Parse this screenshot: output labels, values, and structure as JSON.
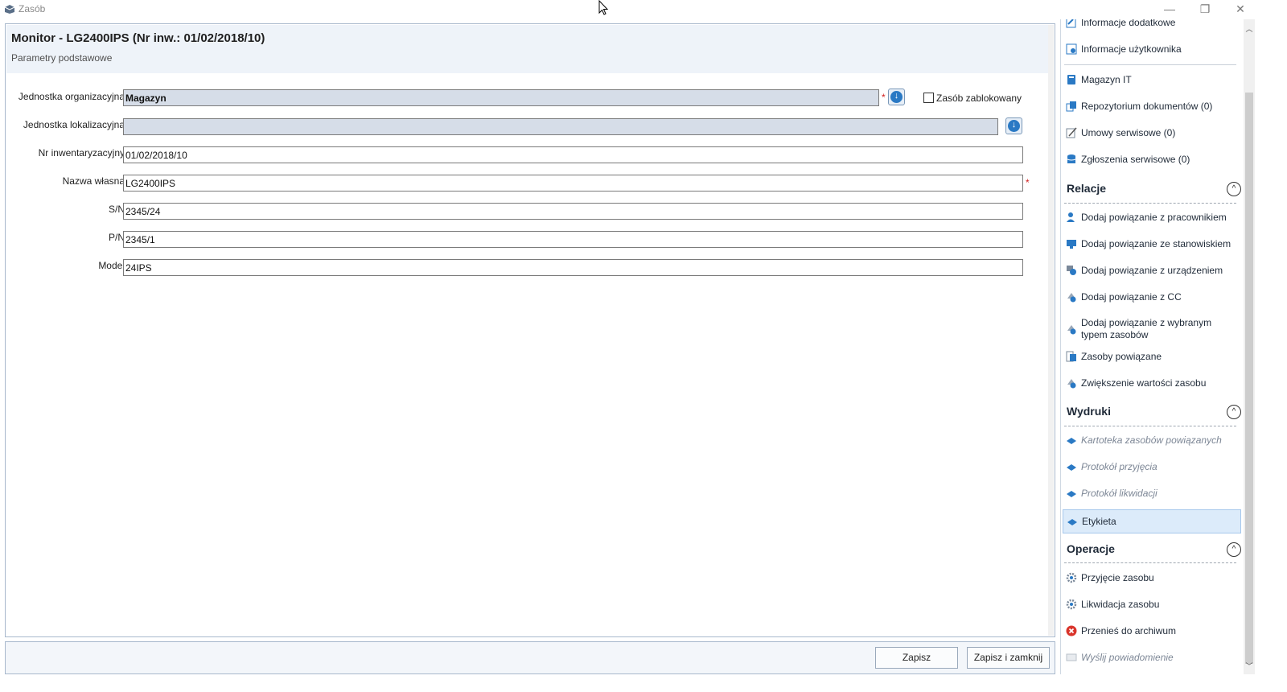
{
  "window": {
    "title": "Zasób",
    "minimize": "—",
    "restore": "❐",
    "close": "✕"
  },
  "form": {
    "title": "Monitor - LG2400IPS (Nr inw.: 01/02/2018/10)",
    "subtitle": "Parametry podstawowe",
    "fields": {
      "org_unit_label": "Jednostka organizacyjna",
      "org_unit_value": "Magazyn",
      "loc_unit_label": "Jednostka lokalizacyjna",
      "loc_unit_value": "",
      "inv_no_label": "Nr inwentaryzacyjny",
      "inv_no_value": "01/02/2018/10",
      "name_label": "Nazwa własna",
      "name_value": "LG2400IPS",
      "sn_label": "S/N",
      "sn_value": "2345/24",
      "pn_label": "P/N",
      "pn_value": "2345/1",
      "model_label": "Model",
      "model_value": "24IPS"
    },
    "blocked_label": "Zasób zablokowany",
    "blocked_checked": false,
    "required_mark": "*"
  },
  "buttons": {
    "save": "Zapisz",
    "save_close": "Zapisz i zamknij"
  },
  "side": {
    "top_items": [
      {
        "label": "Informacje dodatkowe",
        "icon": "edit-doc-icon"
      },
      {
        "label": "Informacje użytkownika",
        "icon": "user-doc-icon"
      },
      {
        "label": "Magazyn IT",
        "icon": "warehouse-icon"
      },
      {
        "label": "Repozytorium dokumentów (0)",
        "icon": "documents-icon"
      },
      {
        "label": "Umowy serwisowe (0)",
        "icon": "contract-icon"
      },
      {
        "label": "Zgłoszenia serwisowe (0)",
        "icon": "service-request-icon"
      }
    ],
    "relations": {
      "title": "Relacje",
      "collapse": "^",
      "items": [
        {
          "label": "Dodaj powiązanie z pracownikiem",
          "icon": "link-employee-icon"
        },
        {
          "label": "Dodaj powiązanie ze stanowiskiem",
          "icon": "link-workstation-icon"
        },
        {
          "label": "Dodaj powiązanie z urządzeniem",
          "icon": "link-device-icon"
        },
        {
          "label": "Dodaj powiązanie z CC",
          "icon": "link-cc-icon"
        },
        {
          "label_line1": "Dodaj powiązanie z wybranym",
          "label_line2": "typem zasobów",
          "icon": "link-type-icon"
        },
        {
          "label": "Zasoby powiązane",
          "icon": "related-resources-icon"
        },
        {
          "label": "Zwiększenie wartości zasobu",
          "icon": "increase-value-icon"
        }
      ]
    },
    "prints": {
      "title": "Wydruki",
      "collapse": "^",
      "items": [
        {
          "label": "Kartoteka zasobów powiązanych",
          "icon": "print-icon"
        },
        {
          "label": "Protokół przyjęcia",
          "icon": "print-icon"
        },
        {
          "label": "Protokół likwidacji",
          "icon": "print-icon"
        },
        {
          "label": "Etykieta",
          "icon": "print-icon"
        }
      ]
    },
    "operations": {
      "title": "Operacje",
      "collapse": "^",
      "items": [
        {
          "label": "Przyjęcie zasobu",
          "icon": "gear-icon"
        },
        {
          "label": "Likwidacja zasobu",
          "icon": "gear-icon"
        },
        {
          "label": "Przenieś do archiwum",
          "icon": "cancel-icon"
        },
        {
          "label": "Wyślij powiadomienie",
          "icon": "notification-icon"
        }
      ]
    }
  },
  "colors": {
    "accent": "#2a79c4",
    "header_bg": "#eef3f9",
    "readonly_bg": "#d6dde8",
    "active_item_bg": "#dcebfa",
    "required": "#d02020"
  }
}
